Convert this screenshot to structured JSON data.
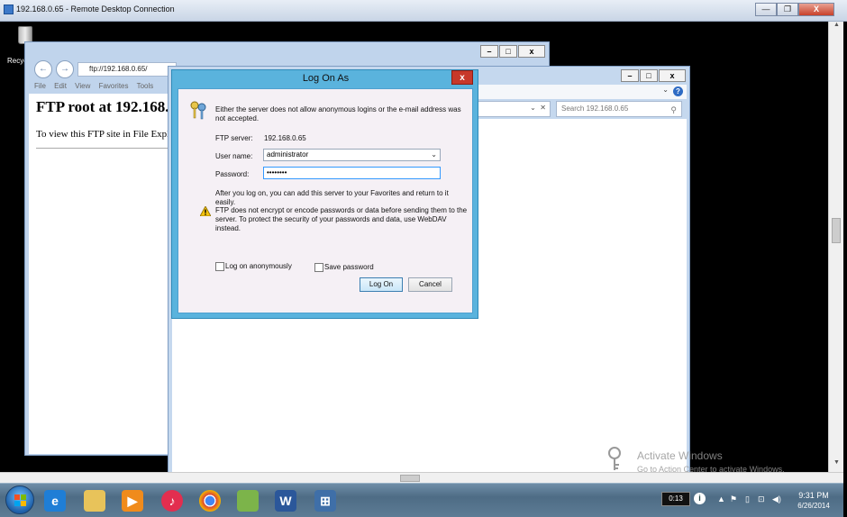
{
  "rdp": {
    "title": "192.168.0.65 - Remote Desktop Connection",
    "minimize": "—",
    "restore": "❐",
    "close": "X"
  },
  "desktop": {
    "recycle_label": "Recyc"
  },
  "ie": {
    "address": "ftp://192.168.0.65/",
    "menu": [
      "File",
      "Edit",
      "View",
      "Favorites",
      "Tools"
    ],
    "heading": "FTP root at 192.168.0.65",
    "body_text": "To view this FTP site in File Explorer"
  },
  "explorer": {
    "search_placeholder": "Search 192.168.0.65"
  },
  "dialog": {
    "title": "Log On As",
    "message": "Either the server does not allow anonymous logins or the e-mail address was not accepted.",
    "ftp_server_label": "FTP server:",
    "ftp_server_value": "192.168.0.65",
    "username_label": "User name:",
    "username_value": "administrator",
    "password_label": "Password:",
    "password_value": "••••••••",
    "after_logon_text": "After you log on, you can add this server to your Favorites and return to it easily.",
    "warning_text": "FTP does not encrypt or encode passwords or data before sending them to the server.  To protect the security of your passwords and data, use WebDAV instead.",
    "anonymous_label": "Log on anonymously",
    "save_password_label": "Save password",
    "logon_button": "Log On",
    "cancel_button": "Cancel"
  },
  "watermark": {
    "line1": "Activate Windows",
    "line2": "Go to Action Center to activate Windows."
  },
  "taskbar": {
    "timer": "0:13",
    "time": "9:31 PM",
    "date": "6/26/2014",
    "pinned": [
      "internet-explorer",
      "file-explorer",
      "media-player",
      "itunes",
      "chrome",
      "photos",
      "word",
      "remote-desktop"
    ]
  },
  "colors": {
    "dialog_frame": "#5ab3dd",
    "close_red": "#c7382a",
    "taskbar": "#5d7c95"
  }
}
